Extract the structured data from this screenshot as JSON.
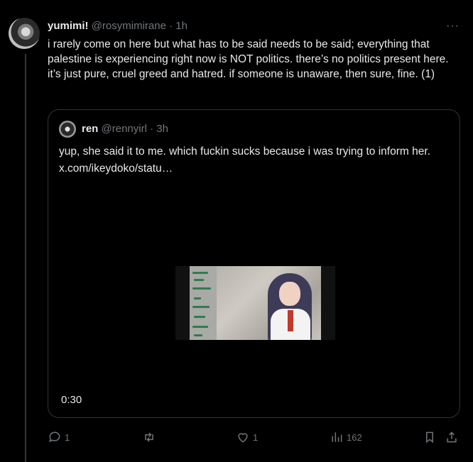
{
  "tweet": {
    "author_name": "yumimi!",
    "author_handle": "@rosymimirane",
    "separator": "·",
    "time": "1h",
    "more_label": "···",
    "text": "i rarely come on here but what has to be said needs to be said; everything that palestine is experiencing right now is NOT politics. there’s no politics present here. it’s just pure, cruel greed and hatred. if someone is unaware, then sure, fine. (1)"
  },
  "quote": {
    "author_name": "ren",
    "author_handle": "@rennyirl",
    "separator": "·",
    "time": "3h",
    "text": "yup, she said it to me. which fuckin sucks because i was trying to inform her.  x.com/ikeydoko/statu…",
    "video_duration": "0:30"
  },
  "actions": {
    "replies": "1",
    "retweets": "",
    "likes": "1",
    "views": "162"
  },
  "icons": {
    "reply": "reply-icon",
    "retweet": "retweet-icon",
    "like": "heart-icon",
    "views": "views-icon",
    "bookmark": "bookmark-icon",
    "share": "share-icon"
  },
  "colors": {
    "background": "#000000",
    "text": "#e7e9ea",
    "muted": "#71767b",
    "border": "#2f3336"
  }
}
